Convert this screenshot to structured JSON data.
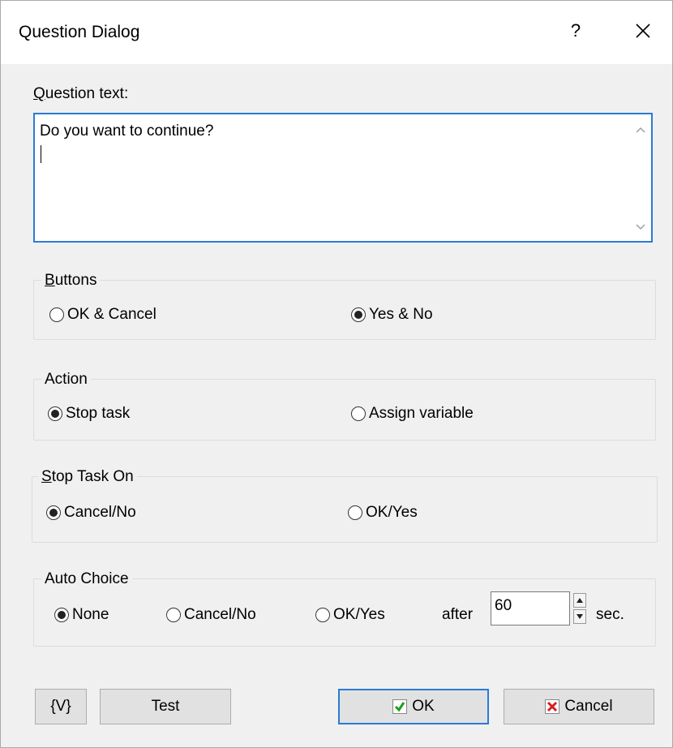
{
  "window": {
    "title": "Question Dialog",
    "help_label": "?",
    "close_label": "✕"
  },
  "question": {
    "label": "Question text:",
    "value": "Do you want to continue?"
  },
  "buttons_group": {
    "label": "Buttons",
    "options": [
      {
        "label": "OK & Cancel",
        "selected": false
      },
      {
        "label": "Yes & No",
        "selected": true
      }
    ]
  },
  "action_group": {
    "label": "Action",
    "options": [
      {
        "label": "Stop task",
        "selected": true
      },
      {
        "label": "Assign variable",
        "selected": false
      }
    ]
  },
  "stop_task_group": {
    "label": "Stop Task On",
    "options": [
      {
        "label": "Cancel/No",
        "selected": true
      },
      {
        "label": "OK/Yes",
        "selected": false
      }
    ]
  },
  "auto_choice_group": {
    "label": "Auto Choice",
    "options": [
      {
        "label": "None",
        "selected": true
      },
      {
        "label": "Cancel/No",
        "selected": false
      },
      {
        "label": "OK/Yes",
        "selected": false
      }
    ],
    "after_label": "after",
    "seconds_value": "60",
    "sec_label": "sec."
  },
  "footer": {
    "variables_button": "{V}",
    "test_button": "Test",
    "ok_button": "OK",
    "cancel_button": "Cancel"
  },
  "colors": {
    "focus_border": "#2b7bd4",
    "ok_check": "#1f9d1f",
    "cancel_x": "#d42020"
  }
}
